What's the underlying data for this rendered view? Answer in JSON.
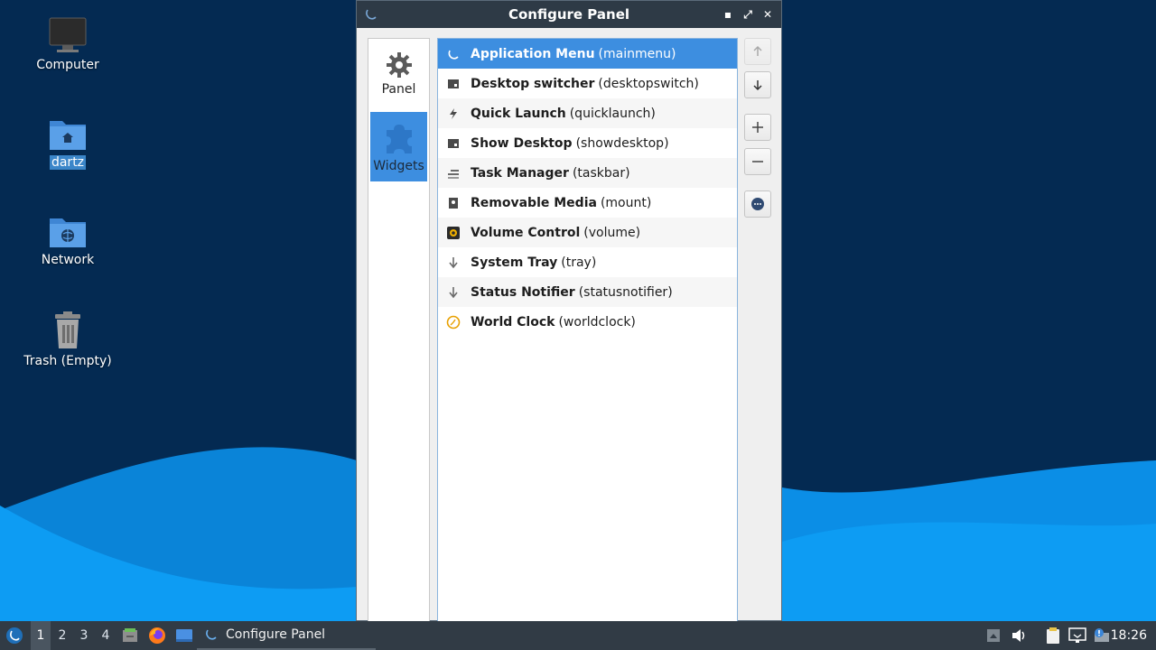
{
  "desktop": {
    "icons": [
      {
        "label": "Computer",
        "icon": "computer-icon"
      },
      {
        "label": "dartz",
        "icon": "home-folder-icon"
      },
      {
        "label": "Network",
        "icon": "network-folder-icon"
      },
      {
        "label": "Trash (Empty)",
        "icon": "trash-icon"
      }
    ]
  },
  "window": {
    "title": "Configure Panel",
    "controls": {
      "minimize": "▪",
      "maximize": "⤢",
      "close": "✕"
    }
  },
  "nav": {
    "items": [
      {
        "label": "Panel",
        "icon": "gear-icon"
      },
      {
        "label": "Widgets",
        "icon": "puzzle-icon",
        "active": true
      }
    ]
  },
  "widgets": [
    {
      "name": "Application Menu",
      "id": "(mainmenu)",
      "icon": "lxqt-logo-icon",
      "selected": true
    },
    {
      "name": "Desktop switcher",
      "id": "(desktopswitch)",
      "icon": "desktop-switch-icon"
    },
    {
      "name": "Quick Launch",
      "id": "(quicklaunch)",
      "icon": "lightning-icon"
    },
    {
      "name": "Show Desktop",
      "id": "(showdesktop)",
      "icon": "show-desktop-icon"
    },
    {
      "name": "Task Manager",
      "id": "(taskbar)",
      "icon": "taskbar-icon"
    },
    {
      "name": "Removable Media",
      "id": "(mount)",
      "icon": "removable-media-icon"
    },
    {
      "name": "Volume Control",
      "id": "(volume)",
      "icon": "speaker-icon"
    },
    {
      "name": "System Tray",
      "id": "(tray)",
      "icon": "tray-arrow-icon"
    },
    {
      "name": "Status Notifier",
      "id": "(statusnotifier)",
      "icon": "status-arrow-icon"
    },
    {
      "name": "World Clock",
      "id": "(worldclock)",
      "icon": "clock-icon"
    }
  ],
  "side_buttons": [
    "move-up",
    "move-down",
    "add",
    "remove",
    "configure"
  ],
  "taskbar": {
    "desktops": [
      "1",
      "2",
      "3",
      "4"
    ],
    "active_desktop": "1",
    "task_label": "Configure Panel",
    "clock": "18:26"
  },
  "colors": {
    "accent": "#3d8ee0",
    "titlebar": "#2e3a46",
    "taskbar": "#313b45",
    "desktop": "#042a52"
  }
}
